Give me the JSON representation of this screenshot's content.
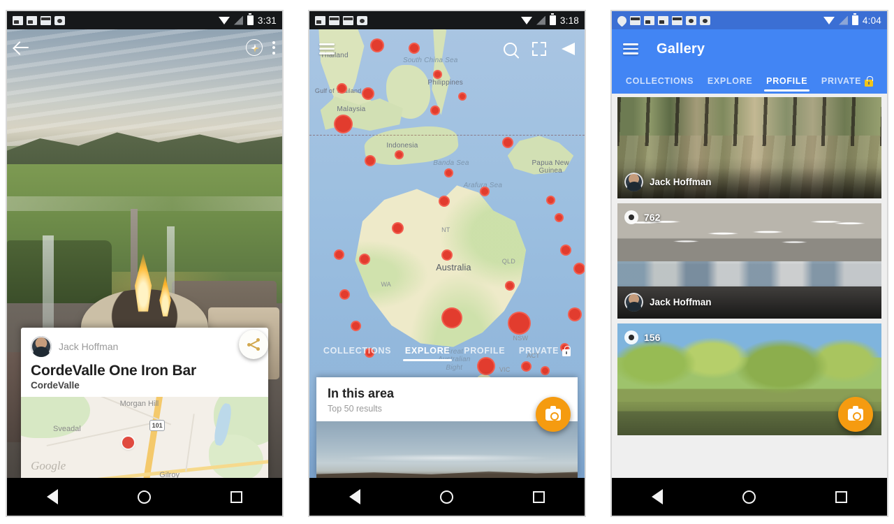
{
  "phones": [
    {
      "id": "phone-photo-detail",
      "statusbar": {
        "time": "3:31",
        "icons": [
          "photo-icon",
          "photo-icon",
          "mail-icon",
          "camera-icon"
        ],
        "wifi": "wifi-icon",
        "signal": "signal-icon",
        "battery": "battery-icon"
      },
      "topbar": {
        "back": "back-arrow-icon",
        "compass": "compass-icon",
        "overflow": "overflow-menu-icon"
      },
      "hero_alt": "Fire pit on patio overlooking golf course at dusk",
      "share_fab": "share-icon",
      "card": {
        "author": "Jack Hoffman",
        "title": "CordeValle One Iron Bar",
        "subtitle": "CordeValle",
        "map": {
          "labels": [
            "Morgan Hill",
            "Sveadal",
            "Gilroy"
          ],
          "highway_shield": "101",
          "attribution": "Google",
          "pin": "map-pin"
        }
      }
    },
    {
      "id": "phone-explore-map",
      "statusbar": {
        "time": "3:18",
        "icons": [
          "photo-icon",
          "mail-icon",
          "mail-icon",
          "camera-icon"
        ]
      },
      "topbar": {
        "menu": "hamburger-icon",
        "search": "search-icon",
        "expand": "expand-icon",
        "navigate": "navigate-icon"
      },
      "map_labels": [
        "Thailand",
        "South China Sea",
        "Philippines",
        "Malaysia",
        "Gulf of Thailand",
        "Indonesia",
        "Banda Sea",
        "Arafura Sea",
        "Papua New Guinea",
        "Australia",
        "NT",
        "QLD",
        "WA",
        "NSW",
        "VIC",
        "ACT",
        "Great Australian Bight"
      ],
      "tabs": [
        {
          "label": "COLLECTIONS",
          "active": false
        },
        {
          "label": "EXPLORE",
          "active": true
        },
        {
          "label": "PROFILE",
          "active": false
        },
        {
          "label": "PRIVATE",
          "active": false,
          "icon": "lock-icon"
        }
      ],
      "sheet": {
        "title": "In this area",
        "subtitle": "Top 50 results"
      },
      "fab": "camera-icon"
    },
    {
      "id": "phone-gallery-profile",
      "statusbar": {
        "time": "4:04",
        "icons": [
          "location-icon",
          "mail-icon",
          "photo-icon",
          "photo-icon",
          "mail-icon",
          "camera-icon",
          "camera-icon"
        ]
      },
      "appbar": {
        "menu": "hamburger-icon",
        "title": "Gallery"
      },
      "tabs": [
        {
          "label": "COLLECTIONS",
          "active": false
        },
        {
          "label": "EXPLORE",
          "active": false
        },
        {
          "label": "PROFILE",
          "active": true
        },
        {
          "label": "PRIVATE",
          "active": false,
          "icon": "lock-icon"
        }
      ],
      "items": [
        {
          "author": "Jack Hoffman",
          "views": null,
          "alt": "Forest trail panorama"
        },
        {
          "author": "Jack Hoffman",
          "views": "762",
          "alt": "Office cafeteria panorama"
        },
        {
          "author": null,
          "views": "156",
          "alt": "Autumn trees with bicycles panorama"
        }
      ],
      "fab": "camera-icon"
    }
  ],
  "navbar": {
    "back": "back-triangle-icon",
    "home": "home-circle-icon",
    "recents": "recents-square-icon"
  },
  "colors": {
    "brand_blue": "#4285f4",
    "status_blue": "#3b6fd4",
    "fab_orange": "#f59b10",
    "map_dot": "#e23c2e"
  }
}
